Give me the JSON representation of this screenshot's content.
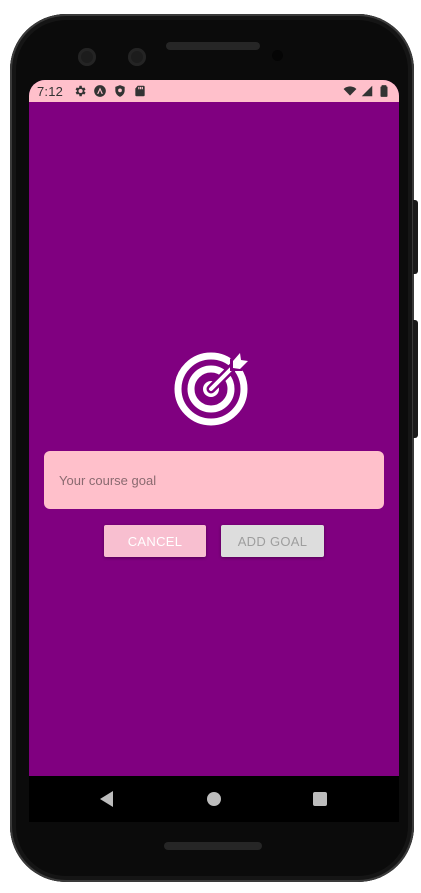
{
  "status_bar": {
    "time": "7:12",
    "icons": [
      "gear-icon",
      "android-icon",
      "shield-icon",
      "sd-card-icon"
    ],
    "right_icons": [
      "wifi-icon",
      "signal-icon",
      "battery-icon"
    ],
    "background": "#ffc0cb"
  },
  "screen": {
    "background": "#800080",
    "goal_image": "target-icon",
    "input": {
      "placeholder": "Your course goal",
      "value": ""
    },
    "buttons": {
      "cancel_label": "CANCEL",
      "add_label": "ADD GOAL"
    }
  },
  "nav_bar": {
    "items": [
      "back-icon",
      "home-icon",
      "recents-icon"
    ]
  }
}
